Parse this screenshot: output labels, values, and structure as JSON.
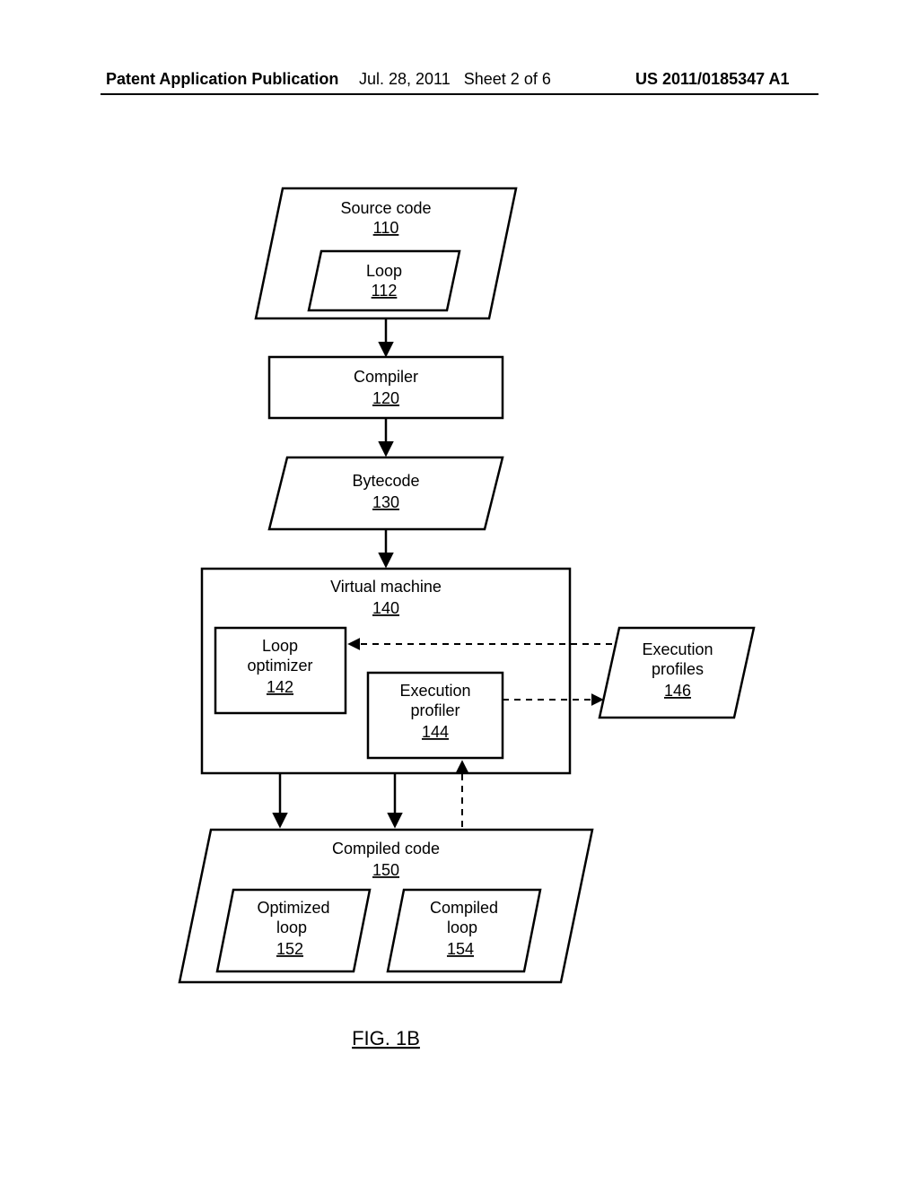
{
  "header": {
    "left": "Patent Application Publication",
    "date": "Jul. 28, 2011",
    "sheet": "Sheet 2 of 6",
    "pubnum": "US 2011/0185347 A1"
  },
  "figure_label": "FIG. 1B",
  "boxes": {
    "source_code": {
      "label": "Source code",
      "ref": "110"
    },
    "loop": {
      "label": "Loop",
      "ref": "112"
    },
    "compiler": {
      "label": "Compiler",
      "ref": "120"
    },
    "bytecode": {
      "label": "Bytecode",
      "ref": "130"
    },
    "vm": {
      "label": "Virtual machine",
      "ref": "140"
    },
    "loop_opt": {
      "label": "Loop\noptimizer",
      "ref": "142"
    },
    "exec_prof": {
      "label": "Execution\nprofiler",
      "ref": "144"
    },
    "exec_profiles": {
      "label": "Execution\nprofiles",
      "ref": "146"
    },
    "compiled_code": {
      "label": "Compiled code",
      "ref": "150"
    },
    "opt_loop": {
      "label": "Optimized\nloop",
      "ref": "152"
    },
    "comp_loop": {
      "label": "Compiled\nloop",
      "ref": "154"
    }
  }
}
